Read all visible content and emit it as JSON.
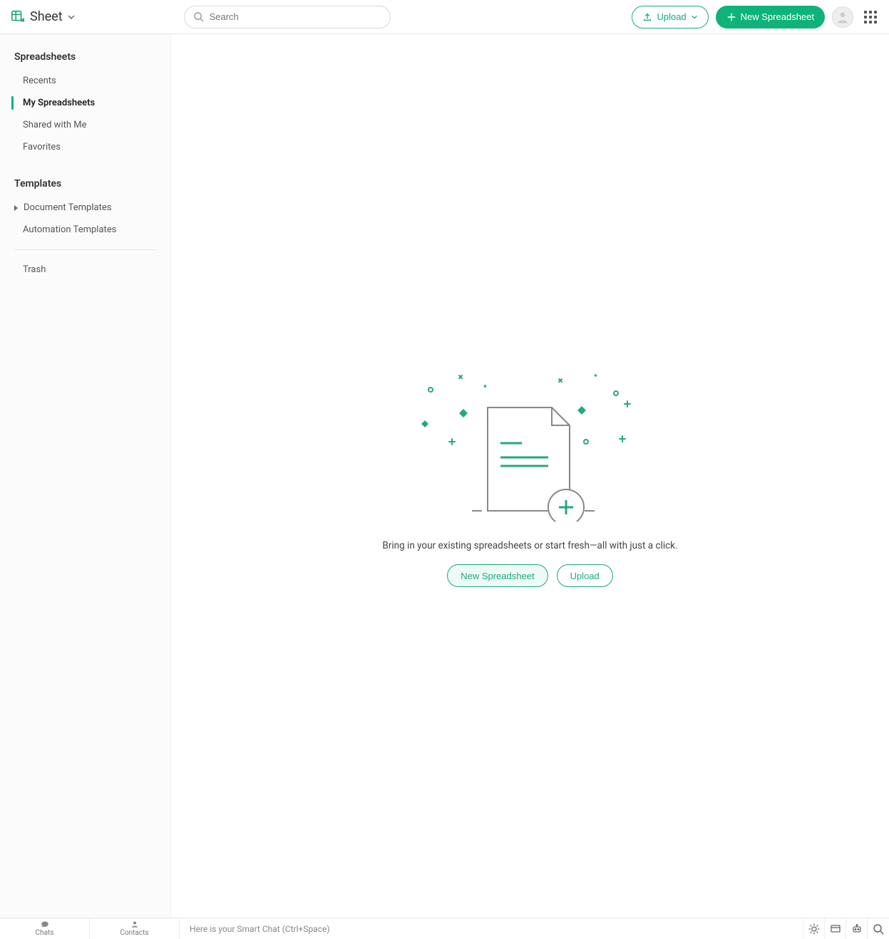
{
  "header": {
    "app_name": "Sheet",
    "search_placeholder": "Search",
    "upload_label": "Upload",
    "new_label": "New Spreadsheet"
  },
  "sidebar": {
    "section_spreadsheets": "Spreadsheets",
    "items": [
      {
        "label": "Recents"
      },
      {
        "label": "My Spreadsheets"
      },
      {
        "label": "Shared with Me"
      },
      {
        "label": "Favorites"
      }
    ],
    "section_templates": "Templates",
    "template_items": [
      {
        "label": "Document Templates"
      },
      {
        "label": "Automation Templates"
      }
    ],
    "trash_label": "Trash"
  },
  "empty_state": {
    "message": "Bring in your existing spreadsheets or start fresh—all with just a click.",
    "new_button": "New Spreadsheet",
    "upload_button": "Upload"
  },
  "footer": {
    "chats_label": "Chats",
    "contacts_label": "Contacts",
    "smart_chat_placeholder": "Here is your Smart Chat (Ctrl+Space)"
  }
}
